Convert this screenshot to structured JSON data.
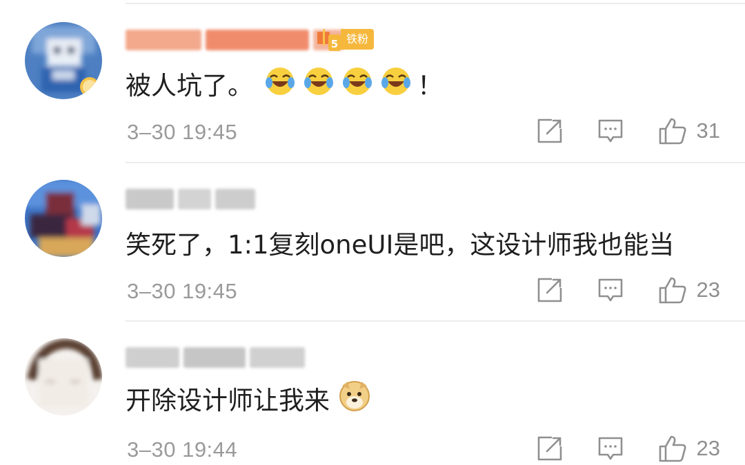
{
  "comments": [
    {
      "text": "被人坑了。",
      "emoji_count": 4,
      "trailing": "！",
      "emoji": "laugh-cry-emoji",
      "badge": {
        "level": "5",
        "label": "铁粉"
      },
      "time": "3–30 19:45",
      "likes": "31"
    },
    {
      "text": "笑死了，1:1复刻oneUI是吧，这设计师我也能当",
      "time": "3–30 19:45",
      "likes": "23"
    },
    {
      "text": "开除设计师让我来",
      "emoji": "doge-emoji",
      "time": "3–30 19:44",
      "likes": "23"
    }
  ],
  "colors": {
    "text": "#1f1f1f",
    "meta": "#9a9a9a",
    "badge": "#f5b83d",
    "divider": "#ececec"
  },
  "icons": [
    "share-icon",
    "reply-icon",
    "like-icon"
  ]
}
